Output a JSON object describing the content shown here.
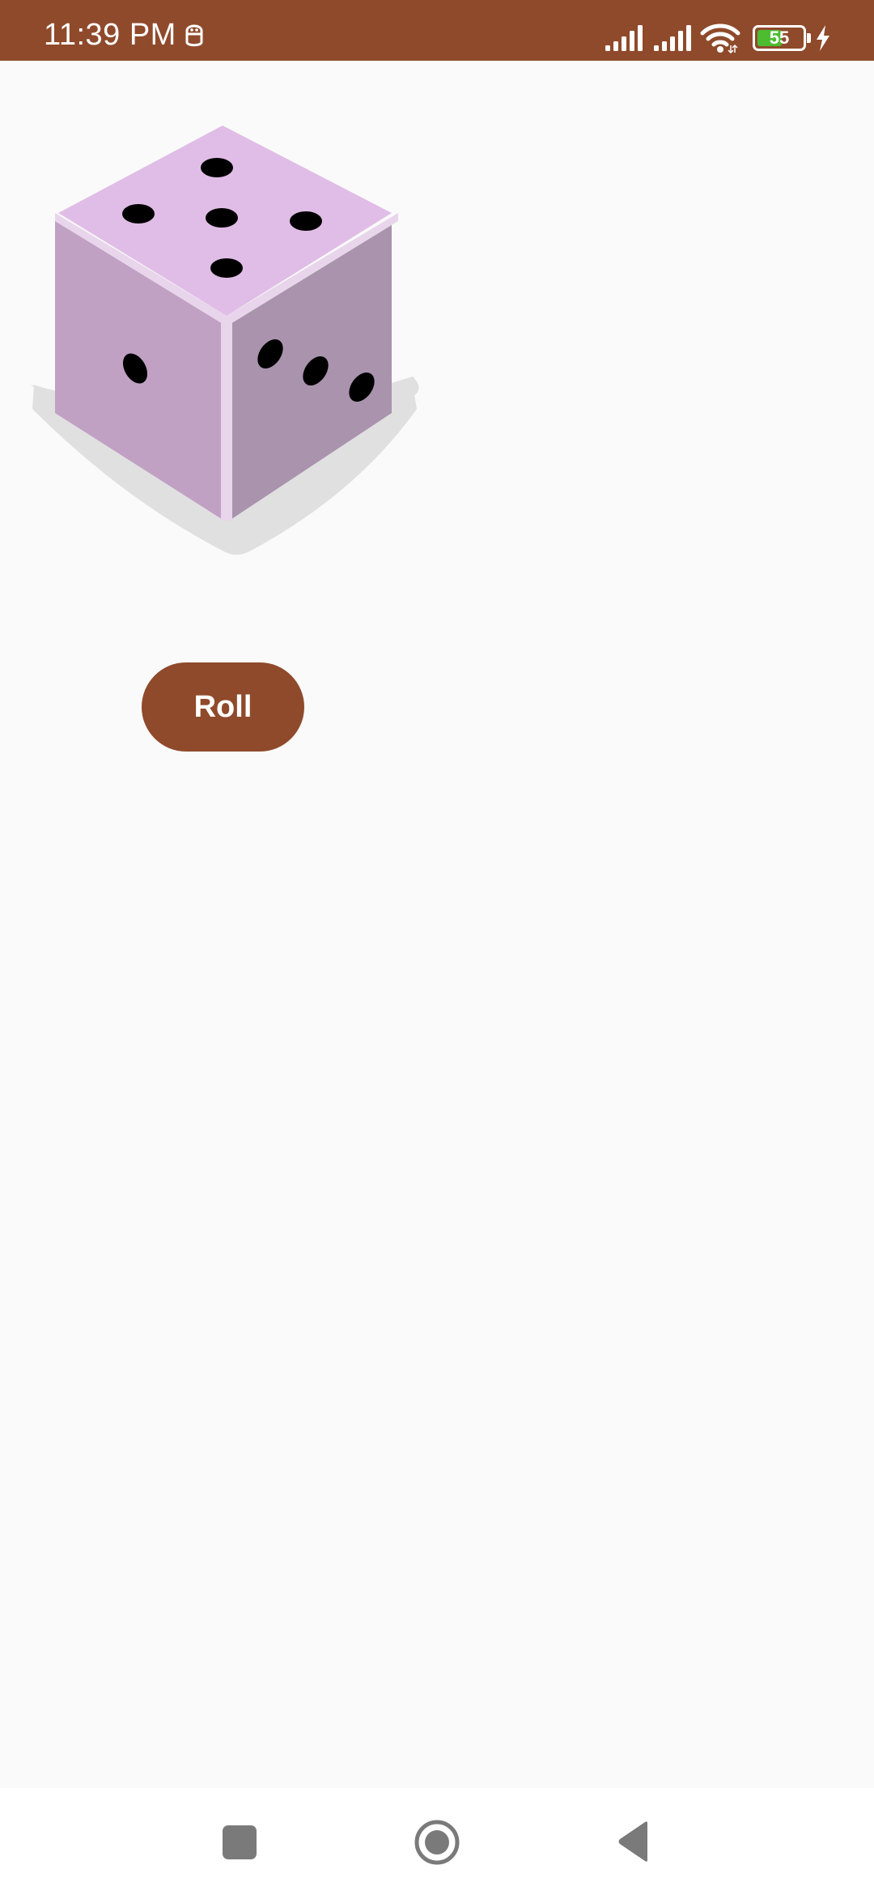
{
  "status_bar": {
    "time": "11:39 PM",
    "battery_level": "55",
    "background_color": "#8f4a2b",
    "icons": [
      "app-notification-icon",
      "signal-icon",
      "signal-icon",
      "wifi-icon",
      "battery-icon",
      "charging-icon"
    ]
  },
  "dice": {
    "top_face_value": 5,
    "left_face_value": 1,
    "right_face_value": 3,
    "colors": {
      "top": "#e0bde6",
      "left": "#c0a1c4",
      "right": "#a993ad",
      "edge": "#e8d5eb",
      "pips": "#000000",
      "shadow": "#e0e0e0"
    }
  },
  "roll_button": {
    "label": "Roll",
    "color": "#8f4a2b"
  },
  "navigation_bar": {
    "icons": [
      "recents-icon",
      "home-icon",
      "back-icon"
    ]
  }
}
